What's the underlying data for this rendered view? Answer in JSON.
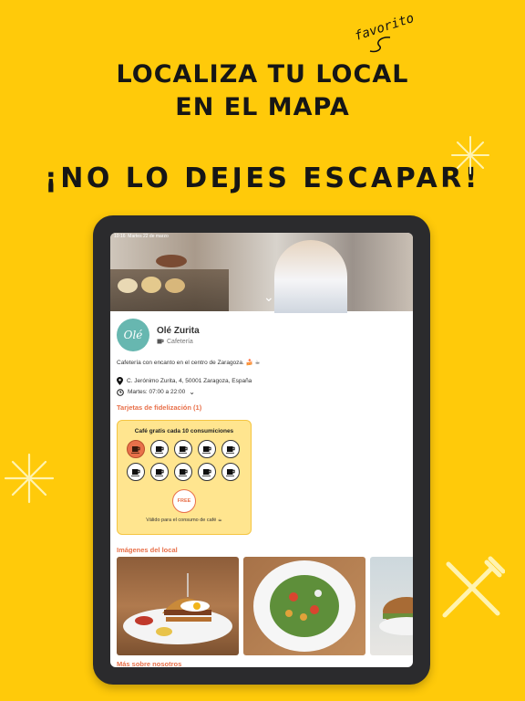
{
  "promo": {
    "line1": "LOCALIZA TU LOCAL",
    "line2": "EN EL MAPA",
    "favorito": "favorito",
    "tagline": "¡NO LO DEJES ESCAPAR!"
  },
  "device": {
    "status_time": "10:16",
    "status_date": "Martes 22 de marzo"
  },
  "business": {
    "logo_text": "Olé",
    "name": "Olé Zurita",
    "category": "Cafetería",
    "category_icon": "coffee-cup-icon",
    "description": "Cafetería con encanto en el centro de Zaragoza. 🍰 ☕",
    "address": "C. Jerónimo Zurita, 4, 50001 Zaragoza, España",
    "hours": "Martes: 07:00 a 22:00"
  },
  "loyalty": {
    "section_title": "Tarjetas de fidelización (1)",
    "card_title": "Café gratis cada 10 consumiciones",
    "stamps_total": 10,
    "stamps_filled": 1,
    "reward_label": "FREE",
    "footer": "Válido para el consumo de café ☕"
  },
  "images": {
    "section_title": "Imágenes del local"
  },
  "more": {
    "section_title": "Más sobre nosotros"
  },
  "colors": {
    "background": "#FFCA0A",
    "accent": "#E8704A",
    "logo": "#67B7B0",
    "card": "#FFE58F"
  }
}
